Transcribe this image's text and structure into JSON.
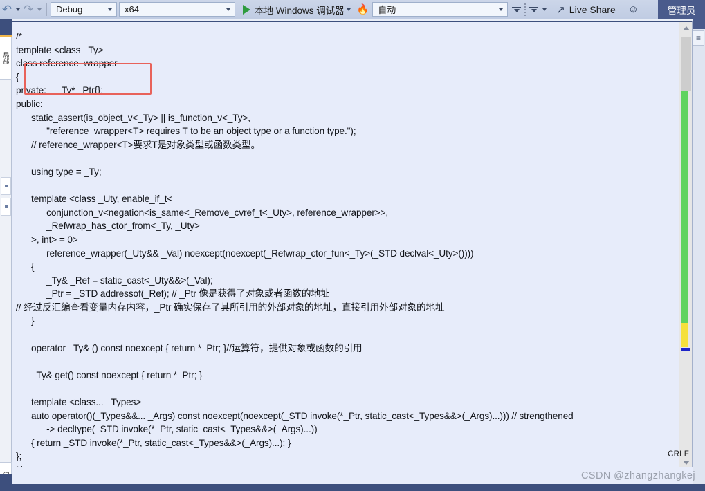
{
  "toolbar": {
    "undo_icon": "undo-arrow-icon",
    "undo_dropdown_icon": "chevron-down-icon",
    "redo_icon": "redo-arrow-icon",
    "redo_dropdown_icon": "chevron-down-icon",
    "configuration": "Debug",
    "platform": "x64",
    "run_icon": "play-triangle-icon",
    "run_label": "本地 Windows 调试器",
    "run_dropdown_icon": "chevron-down-icon",
    "hot_reload_icon": "flame-icon",
    "auto_select": "自动",
    "auto_dropdown_icon": "chevron-down-icon",
    "step_icon": "step-into-icon",
    "step_over_icon": "step-over-icon",
    "live_share_icon": "share-icon",
    "live_share_label": "Live Share",
    "feedback_icon": "person-feedback-icon",
    "admin_badge": "管理员"
  },
  "left_rail": {
    "tab_top_label": "局部",
    "tab_bottom_label": "问题",
    "marker_icon": "collapsed-panel-icon"
  },
  "right_rail": {
    "tool_icon": "properties-icon"
  },
  "editor": {
    "lines": [
      "/*",
      "template <class _Ty>",
      "class reference_wrapper",
      "{",
      "private:    _Ty* _Ptr{};",
      "public:",
      "      static_assert(is_object_v<_Ty> || is_function_v<_Ty>,",
      "            \"reference_wrapper<T> requires T to be an object type or a function type.\");",
      "      // reference_wrapper<T>要求T是对象类型或函数类型。",
      "",
      "      using type = _Ty;",
      "",
      "      template <class _Uty, enable_if_t<",
      "            conjunction_v<negation<is_same<_Remove_cvref_t<_Uty>, reference_wrapper>>,",
      "            _Refwrap_has_ctor_from<_Ty, _Uty>",
      "      >, int> = 0>",
      "            reference_wrapper(_Uty&& _Val) noexcept(noexcept(_Refwrap_ctor_fun<_Ty>(_STD declval<_Uty>())))",
      "      {",
      "            _Ty& _Ref = static_cast<_Uty&&>(_Val);",
      "            _Ptr = _STD addressof(_Ref); // _Ptr 像是获得了对象或者函数的地址",
      "// 经过反汇编查看变量内存内容，_Ptr 确实保存了其所引用的外部对象的地址，直接引用外部对象的地址",
      "      }",
      "",
      "      operator _Ty& () const noexcept { return *_Ptr; }//运算符，提供对象或函数的引用",
      "",
      "      _Ty& get() const noexcept { return *_Ptr; }",
      "",
      "      template <class... _Types>",
      "      auto operator()(_Types&&... _Args) const noexcept(noexcept(_STD invoke(*_Ptr, static_cast<_Types&&>(_Args)...))) // strengthened",
      "            -> decltype(_STD invoke(*_Ptr, static_cast<_Types&&>(_Args)...))",
      "      { return _STD invoke(*_Ptr, static_cast<_Types&&>(_Args)...); }",
      "};",
      "*/"
    ],
    "highlight": {
      "label": "highlighted-code-region",
      "color": "#e8625a",
      "lines": [
        "template <class _Ty>",
        "class reference_wrapper"
      ]
    },
    "line_ending": "CRLF",
    "scrollbar": {
      "up_icon": "scroll-up-arrow-icon",
      "down_icon": "scroll-down-arrow-icon",
      "markers": [
        {
          "name": "changed-lines-marker",
          "color": "#5fd35f"
        },
        {
          "name": "unsaved-changes-marker",
          "color": "#f5e03c"
        },
        {
          "name": "caret-position-marker",
          "color": "#1c24c8"
        }
      ]
    }
  },
  "watermark": {
    "text": "CSDN @zhangzhangkej"
  }
}
